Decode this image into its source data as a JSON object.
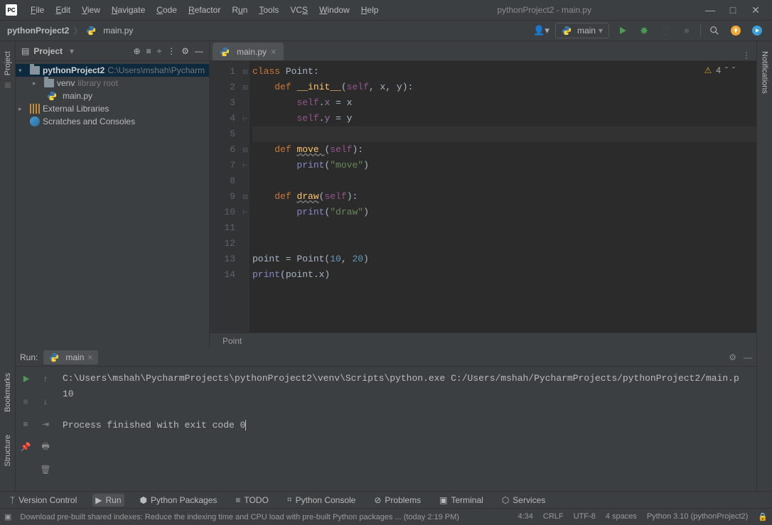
{
  "window": {
    "title": "pythonProject2 - main.py"
  },
  "menubar": [
    "File",
    "Edit",
    "View",
    "Navigate",
    "Code",
    "Refactor",
    "Run",
    "Tools",
    "VCS",
    "Window",
    "Help"
  ],
  "breadcrumb": {
    "project": "pythonProject2",
    "file": "main.py"
  },
  "run_config": {
    "label": "main"
  },
  "project_panel": {
    "title": "Project",
    "root": {
      "name": "pythonProject2",
      "path": "C:\\Users\\mshah\\Pycharm"
    },
    "venv": {
      "name": "venv",
      "tag": "library root"
    },
    "mainfile": "main.py",
    "external": "External Libraries",
    "scratch": "Scratches and Consoles"
  },
  "editor": {
    "tab": "main.py",
    "warnings": "4",
    "crumb": "Point",
    "lines": [
      1,
      2,
      3,
      4,
      5,
      6,
      7,
      8,
      9,
      10,
      11,
      12,
      13,
      14
    ]
  },
  "run": {
    "label": "Run:",
    "tab": "main",
    "output_cmd": "C:\\Users\\mshah\\PycharmProjects\\pythonProject2\\venv\\Scripts\\python.exe C:/Users/mshah/PycharmProjects/pythonProject2/main.p",
    "output_result": "10",
    "output_exit": "Process finished with exit code 0"
  },
  "toolwindows": {
    "vc": "Version Control",
    "run": "Run",
    "pkg": "Python Packages",
    "todo": "TODO",
    "console": "Python Console",
    "problems": "Problems",
    "terminal": "Terminal",
    "services": "Services"
  },
  "status": {
    "msg": "Download pre-built shared indexes: Reduce the indexing time and CPU load with pre-built Python packages ... (today 2:19 PM)",
    "pos": "4:34",
    "sep": "CRLF",
    "enc": "UTF-8",
    "indent": "4 spaces",
    "interp": "Python 3.10 (pythonProject2)"
  },
  "left_rail": {
    "project": "Project"
  },
  "right_rail": {
    "notifications": "Notifications"
  },
  "side_rails": {
    "bookmarks": "Bookmarks",
    "structure": "Structure"
  }
}
